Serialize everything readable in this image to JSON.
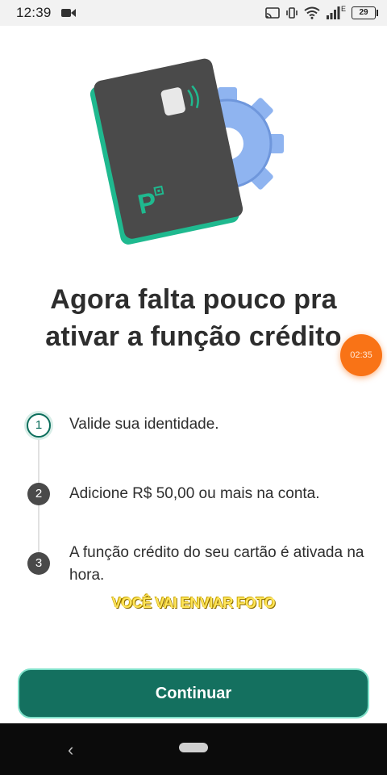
{
  "status_bar": {
    "time": "12:39",
    "network_label": "E",
    "battery": "29"
  },
  "title": {
    "line1": "Agora falta pouco pra",
    "line2": "ativar a função crédito"
  },
  "timer": "02:35",
  "steps": [
    {
      "number": "1",
      "text": "Valide sua identidade."
    },
    {
      "number": "2",
      "text": "Adicione R$ 50,00 ou mais na conta."
    },
    {
      "number": "3",
      "text": "A função crédito do seu cartão é ativada na hora."
    }
  ],
  "overlay_caption": "VOCÊ VAI ENVIAR FOTO",
  "continue_button": "Continuar",
  "colors": {
    "primary": "#14705f",
    "timer": "#f97316",
    "card": "#4a4a4a"
  }
}
